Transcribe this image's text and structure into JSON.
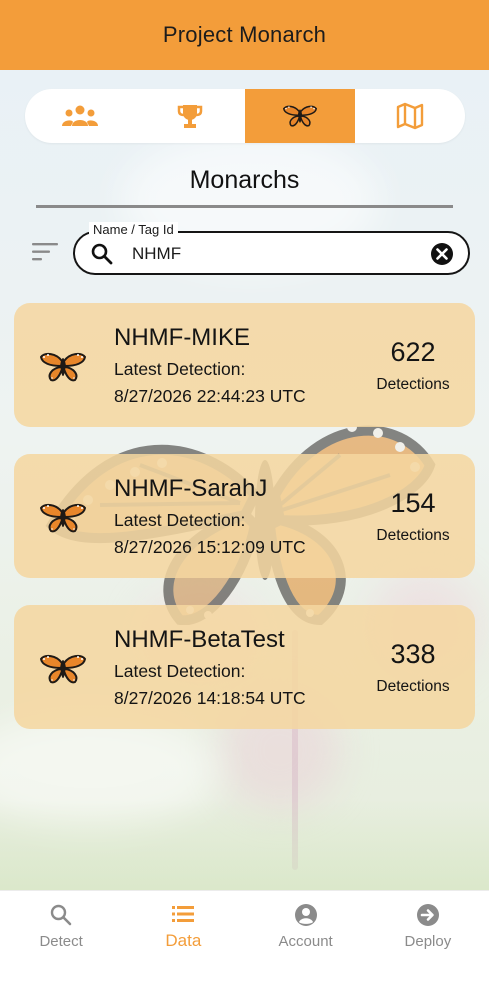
{
  "app": {
    "title": "Project Monarch"
  },
  "tabs": [
    {
      "icon": "group-icon",
      "active": false
    },
    {
      "icon": "trophy-icon",
      "active": false
    },
    {
      "icon": "butterfly-icon",
      "active": true
    },
    {
      "icon": "map-icon",
      "active": false
    }
  ],
  "section": {
    "title": "Monarchs"
  },
  "search": {
    "label": "Name / Tag Id",
    "value": "NHMF"
  },
  "monarchs": [
    {
      "name": "NHMF-MIKE",
      "latest_label": "Latest Detection:",
      "latest_time": "8/27/2026 22:44:23 UTC",
      "count": "622",
      "count_label": "Detections"
    },
    {
      "name": "NHMF-SarahJ",
      "latest_label": "Latest Detection:",
      "latest_time": "8/27/2026 15:12:09 UTC",
      "count": "154",
      "count_label": "Detections"
    },
    {
      "name": "NHMF-BetaTest",
      "latest_label": "Latest Detection:",
      "latest_time": "8/27/2026 14:18:54 UTC",
      "count": "338",
      "count_label": "Detections"
    }
  ],
  "nav": {
    "items": [
      {
        "label": "Detect",
        "icon": "search-icon",
        "active": false
      },
      {
        "label": "Data",
        "icon": "list-icon",
        "active": true
      },
      {
        "label": "Account",
        "icon": "account-icon",
        "active": false
      },
      {
        "label": "Deploy",
        "icon": "arrow-right-circle-icon",
        "active": false
      }
    ]
  },
  "colors": {
    "accent": "#f39d3a",
    "card": "#f5d6a0",
    "inactive": "#8b8b8b"
  }
}
